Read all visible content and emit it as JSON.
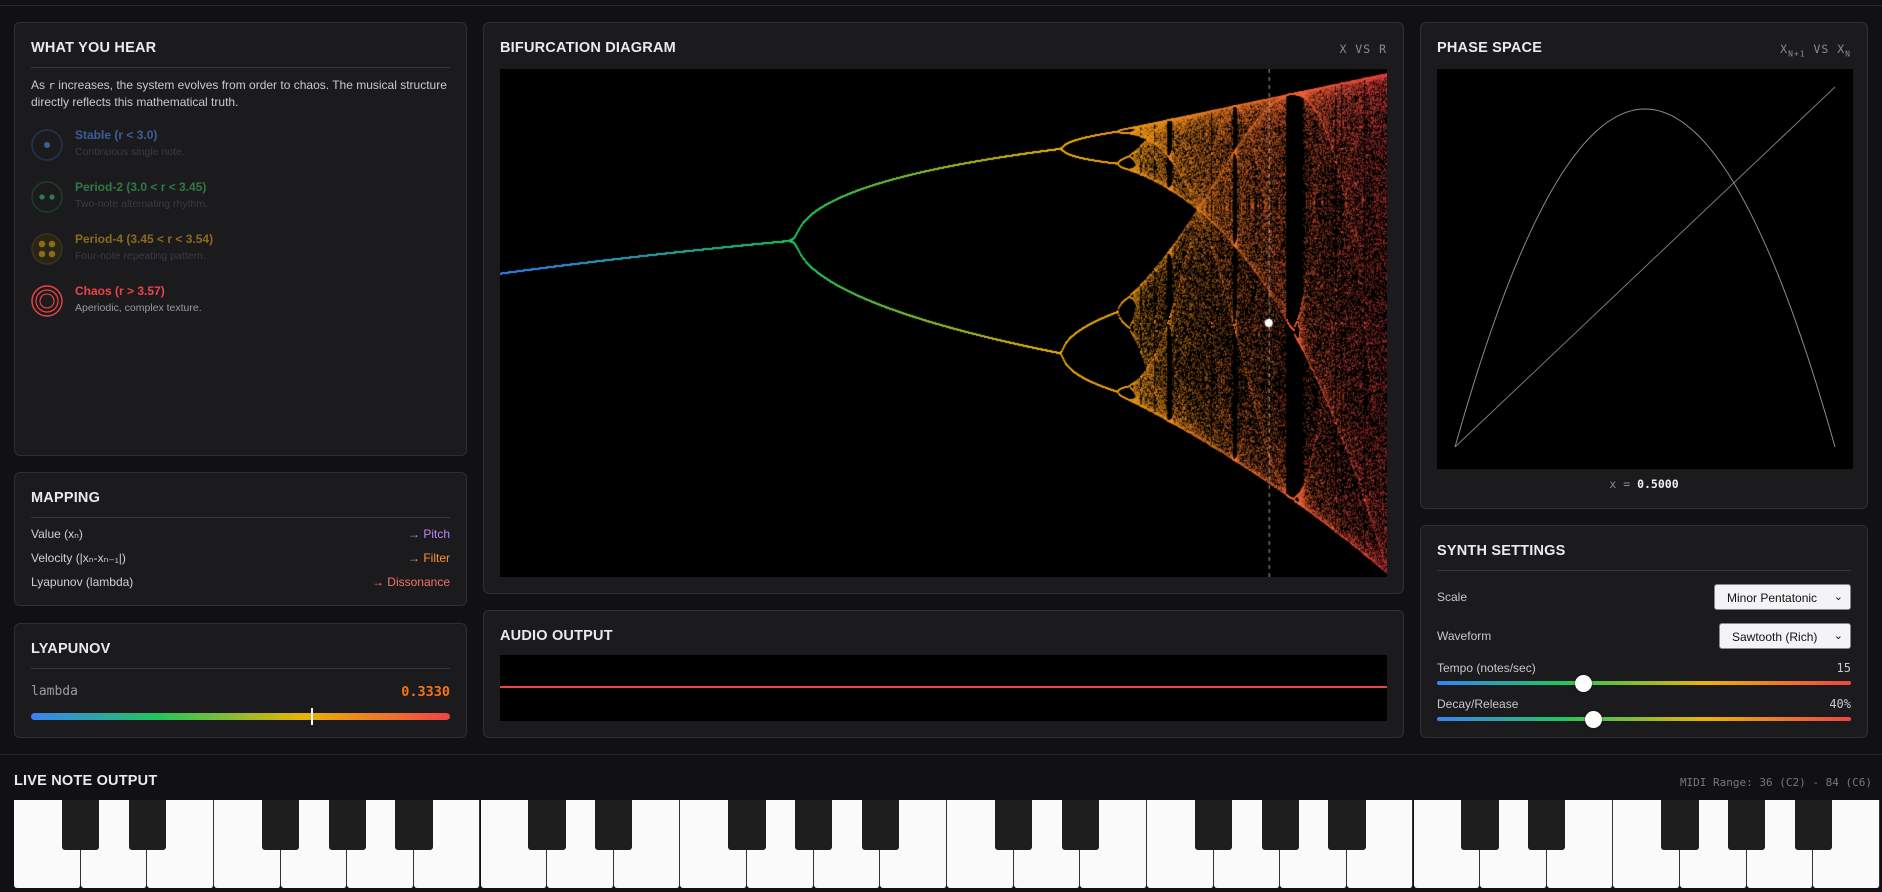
{
  "what_you_hear": {
    "title": "WHAT YOU HEAR",
    "desc_before": "As ",
    "desc_code": "r",
    "desc_after": " increases, the system evolves from order to chaos. The musical structure directly reflects this mathematical truth.",
    "states": [
      {
        "label": "Stable (r < 3.0)",
        "sub": "Continuous single note.",
        "color": "#3b5d99",
        "subcolor": "#3a3a44",
        "icon": "single-dot-icon"
      },
      {
        "label": "Period-2 (3.0 < r < 3.45)",
        "sub": "Two-note alternating rhythm.",
        "color": "#2f7a45",
        "subcolor": "#3a3a44",
        "icon": "two-dots-icon"
      },
      {
        "label": "Period-4 (3.45 < r < 3.54)",
        "sub": "Four-note repeating pattern.",
        "color": "#8a6b1c",
        "subcolor": "#3a3a44",
        "icon": "four-dots-icon"
      },
      {
        "label": "Chaos (r > 3.57)",
        "sub": "Aperiodic, complex texture.",
        "color": "#ef4444",
        "subcolor": "#9a9aa0",
        "icon": "concentric-rings-icon"
      }
    ]
  },
  "mapping": {
    "title": "MAPPING",
    "rows": [
      {
        "k": "Value (xₙ)",
        "v": "→ Pitch",
        "color": "#c084fc"
      },
      {
        "k": "Velocity (|xₙ-xₙ₋₁|)",
        "v": "→ Filter",
        "color": "#fb923c"
      },
      {
        "k": "Lyapunov (lambda)",
        "v": "→ Dissonance",
        "color": "#f87171"
      }
    ]
  },
  "lyapunov": {
    "title": "LYAPUNOV",
    "label": "lambda",
    "value": "0.3330",
    "marker_fraction": 0.667
  },
  "bifurcation": {
    "title": "BIFURCATION DIAGRAM",
    "axes": "X VS R"
  },
  "audio": {
    "title": "AUDIO OUTPUT",
    "waveform_color": "#ef4444"
  },
  "phase": {
    "title": "PHASE SPACE",
    "axes_main": "X",
    "axes_sub1": "N+1",
    "axes_vs": " VS X",
    "axes_sub2": "N",
    "x_label": "x = ",
    "x_value": "0.5000"
  },
  "synth": {
    "title": "SYNTH SETTINGS",
    "scale_label": "Scale",
    "scale_value": "Minor Pentatonic",
    "waveform_label": "Waveform",
    "waveform_value": "Sawtooth (Rich)",
    "tempo_label": "Tempo (notes/sec)",
    "tempo_value": "15",
    "tempo_fraction": 0.35,
    "decay_label": "Decay/Release",
    "decay_value": "40%",
    "decay_fraction": 0.376
  },
  "piano": {
    "title": "LIVE NOTE OUTPUT",
    "range": "MIDI Range: 36 (C2) - 84 (C6)",
    "white_key_count": 28
  },
  "colors": {
    "accent": "#ef4444",
    "panel": "#1b1b1e",
    "background": "#111113"
  }
}
